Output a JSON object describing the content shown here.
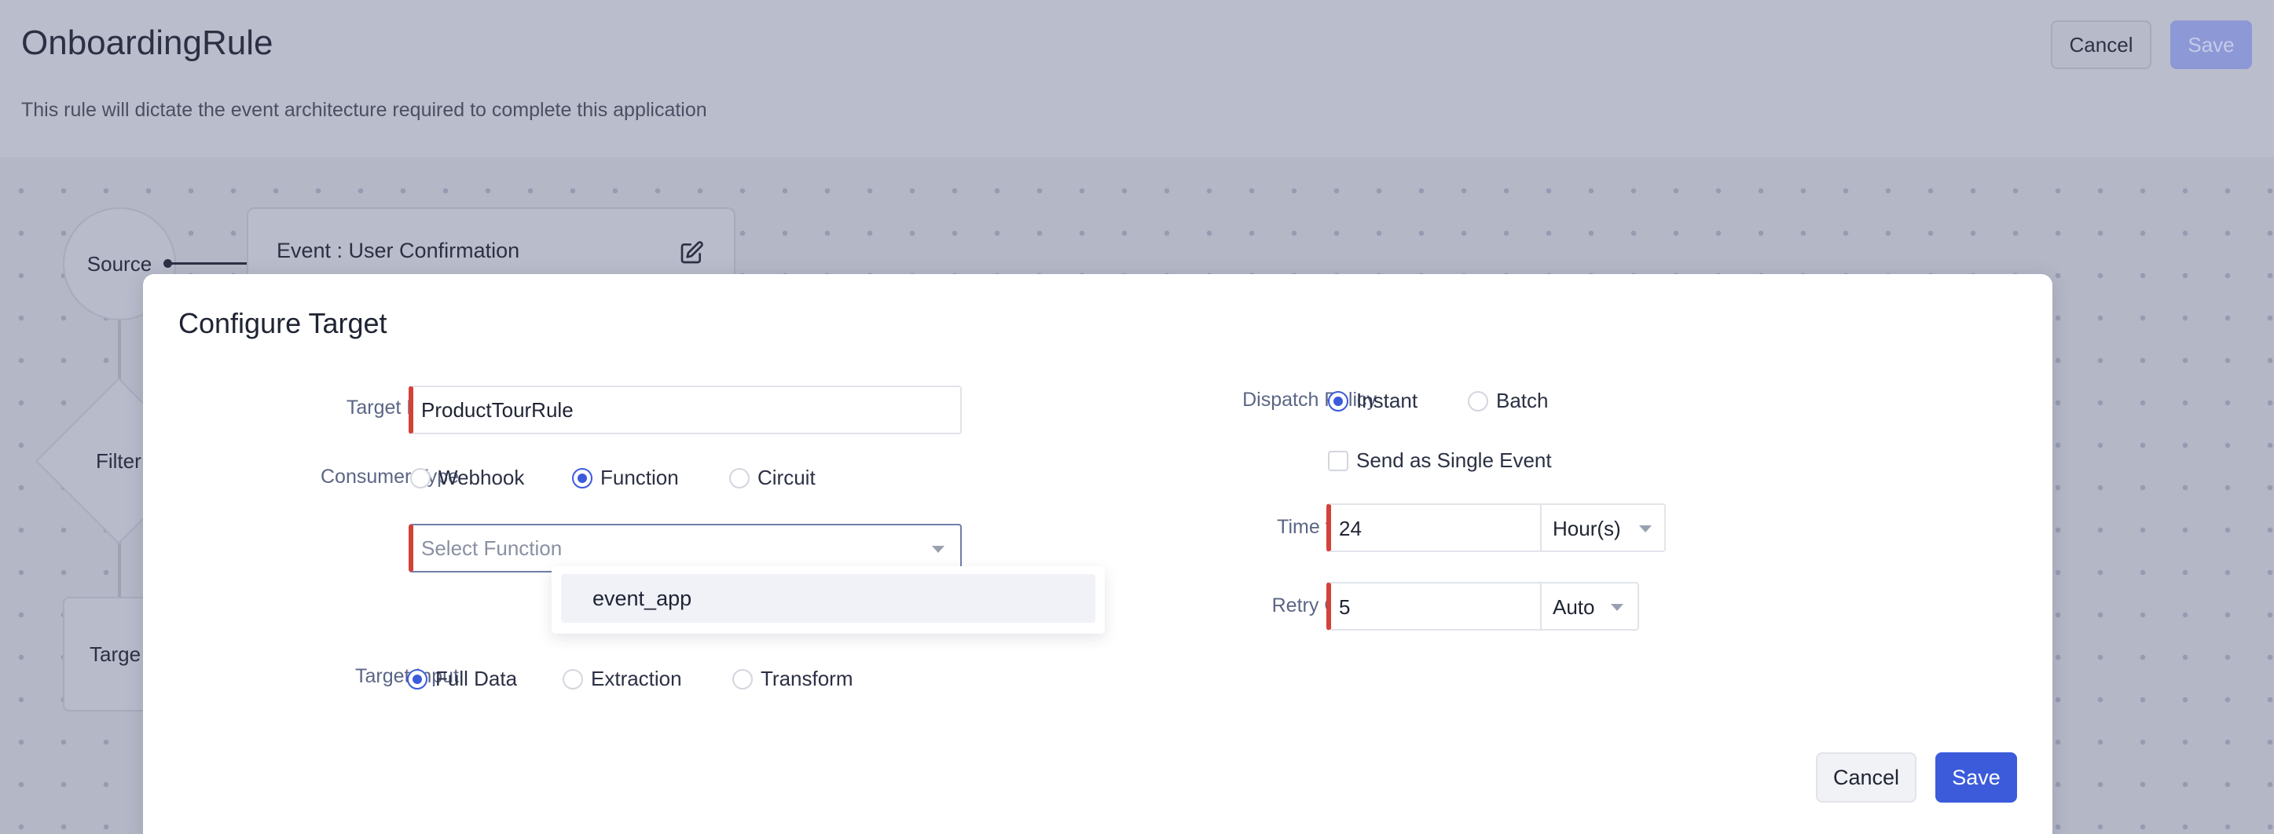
{
  "page": {
    "title": "OnboardingRule",
    "description": "This rule will dictate the event architecture required to complete this application",
    "cancel_label": "Cancel",
    "save_label": "Save"
  },
  "canvas": {
    "source_label": "Source",
    "event_label": "Event : User Confirmation",
    "filter_label": "Filter",
    "target_label": "Targe"
  },
  "modal": {
    "title": "Configure Target",
    "target_name": {
      "label": "Target Name",
      "value": "ProductTourRule"
    },
    "consumer_type": {
      "label": "Consumer Type",
      "options": [
        "Webhook",
        "Function",
        "Circuit"
      ],
      "selected": "Function"
    },
    "function_select": {
      "placeholder": "Select Function",
      "options": [
        "event_app"
      ]
    },
    "target_input": {
      "label": "Target Input",
      "options": [
        "Full Data",
        "Extraction",
        "Transform"
      ],
      "selected": "Full Data"
    },
    "dispatch_policy": {
      "label": "Dispatch Policy",
      "options": [
        "Instant",
        "Batch"
      ],
      "selected": "Instant"
    },
    "send_single": {
      "label": "Send as Single Event",
      "checked": false
    },
    "ttl": {
      "label": "Time to live",
      "value": "24",
      "unit": "Hour(s)"
    },
    "retry": {
      "label": "Retry Count",
      "value": "5",
      "mode": "Auto"
    },
    "cancel_label": "Cancel",
    "save_label": "Save"
  },
  "colors": {
    "accent": "#3b5bdb",
    "required_marker": "#d3423a"
  }
}
